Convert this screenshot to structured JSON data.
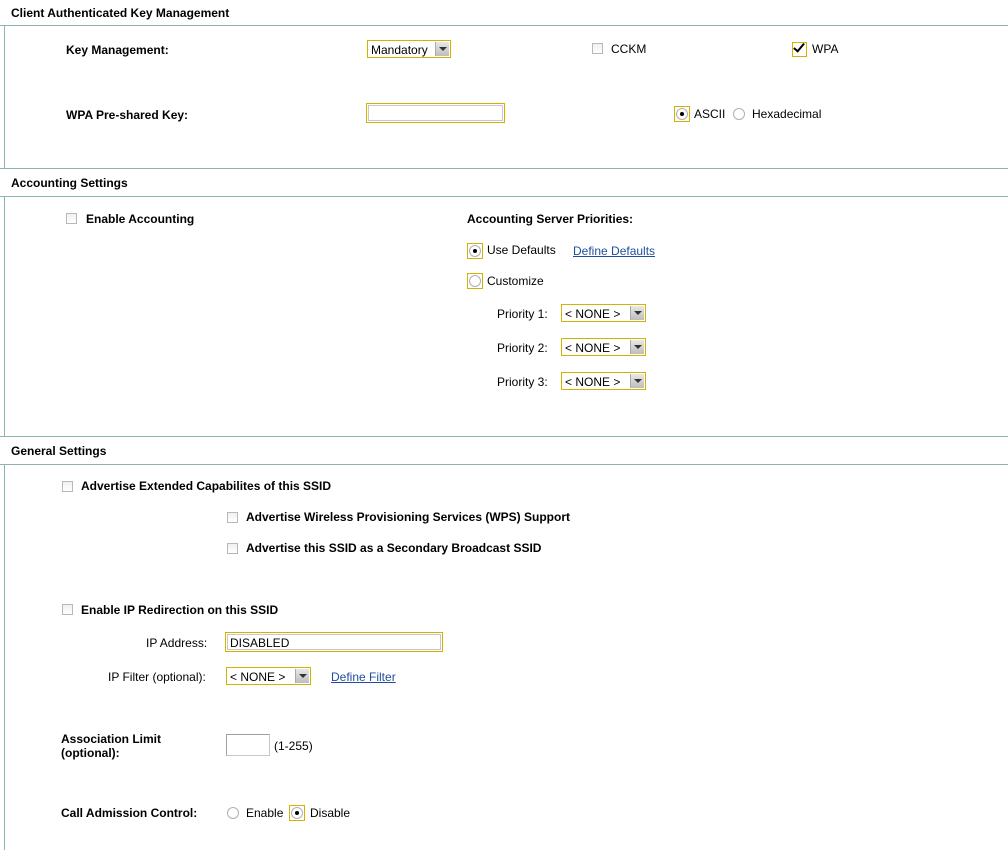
{
  "sections": {
    "client_key_mgmt": "Client Authenticated Key Management",
    "accounting": "Accounting Settings",
    "general": "General Settings"
  },
  "key_mgmt": {
    "label": "Key Management:",
    "select_value": "Mandatory",
    "cckm_label": "CCKM",
    "cckm_checked": false,
    "wpa_label": "WPA",
    "wpa_checked": true
  },
  "wpa_psk": {
    "label": "WPA Pre-shared Key:",
    "value": "",
    "ascii_label": "ASCII",
    "hex_label": "Hexadecimal",
    "selected": "ASCII"
  },
  "accounting": {
    "enable_label": "Enable Accounting",
    "enable_checked": false,
    "priorities_title": "Accounting Server Priorities:",
    "use_defaults_label": "Use Defaults",
    "define_defaults_link": "Define Defaults",
    "customize_label": "Customize",
    "selected": "Use Defaults",
    "priorities": [
      {
        "label": "Priority 1:",
        "value": "< NONE >"
      },
      {
        "label": "Priority 2:",
        "value": "< NONE >"
      },
      {
        "label": "Priority 3:",
        "value": "< NONE >"
      }
    ]
  },
  "general": {
    "advertise_ext_label": "Advertise Extended Capabilites of this SSID",
    "wps_label": "Advertise Wireless Provisioning Services (WPS) Support",
    "secondary_label": "Advertise this SSID as a Secondary Broadcast SSID",
    "ip_redirect_label": "Enable IP Redirection on this SSID",
    "ip_address_label": "IP Address:",
    "ip_address_value": "DISABLED",
    "ip_filter_label": "IP Filter (optional):",
    "ip_filter_value": "< NONE >",
    "define_filter_link": "Define Filter",
    "assoc_limit_label_1": "Association Limit",
    "assoc_limit_label_2": "(optional):",
    "assoc_limit_value": "",
    "assoc_limit_range": "(1-255)",
    "cac_label": "Call Admission Control:",
    "cac_enable_label": "Enable",
    "cac_disable_label": "Disable",
    "cac_selected": "Disable"
  }
}
